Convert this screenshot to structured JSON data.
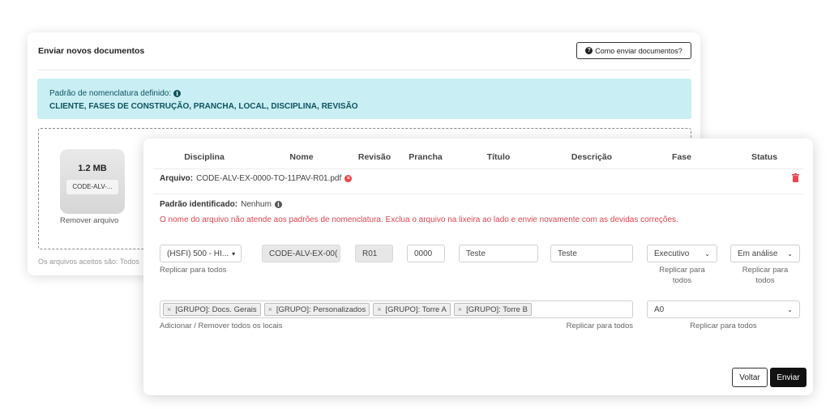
{
  "back_panel": {
    "title": "Enviar novos documentos",
    "help_button": "Como enviar documentos?",
    "naming_label": "Padrão de nomenclatura definido:",
    "naming_pattern": "CLIENTE, FASES DE CONSTRUÇÃO, PRANCHA, LOCAL, DISCIPLINA, REVISÃO",
    "file": {
      "size": "1.2 MB",
      "name": "CODE-ALV-...",
      "remove": "Remover arquivo"
    },
    "footer_partial": "Os arquivos aceitos são: Todos"
  },
  "table": {
    "headers": [
      "Disciplina",
      "Nome",
      "Revisão",
      "Prancha",
      "Título",
      "Descrição",
      "Fase",
      "Status"
    ],
    "file_label": "Arquivo:",
    "file_name": "CODE-ALV-EX-0000-TO-11PAV-R01.pdf",
    "pattern_label": "Padrão identificado:",
    "pattern_value": "Nenhum",
    "error": "O nome do arquivo não atende aos padrões de nomenclatura. Exclua o arquivo na lixeira ao lado e envie novamente com as devidas correções."
  },
  "row": {
    "disciplina": "(HSFI) 500 - HI...",
    "nome": "CODE-ALV-EX-00(",
    "revisao": "R01",
    "prancha": "0000",
    "titulo": "Teste",
    "descricao": "Teste",
    "fase": "Executivo",
    "status": "Em análise",
    "replicar_todos": "Replicar para todos",
    "replicar_para": "Replicar para",
    "todos": "todos"
  },
  "locais": {
    "tags": [
      "[GRUPO]: Docs. Gerais",
      "[GRUPO]: Personalizados",
      "[GRUPO]: Torre A",
      "[GRUPO]: Torre B"
    ],
    "tag_remove": "×",
    "add_remove_all": "Adicionar / Remover todos os locais",
    "replicar": "Replicar para todos",
    "size_select": "A0",
    "size_replicar": "Replicar para todos"
  },
  "actions": {
    "voltar": "Voltar",
    "enviar": "Enviar"
  },
  "colors": {
    "info_bg": "#c9eef3",
    "info_text": "#0c5460",
    "error": "#e0444f",
    "primary": "#111111"
  },
  "icons": [
    "question-circle-icon",
    "info-circle-icon",
    "x-circle-icon",
    "trash-icon",
    "chevron-down-icon"
  ]
}
